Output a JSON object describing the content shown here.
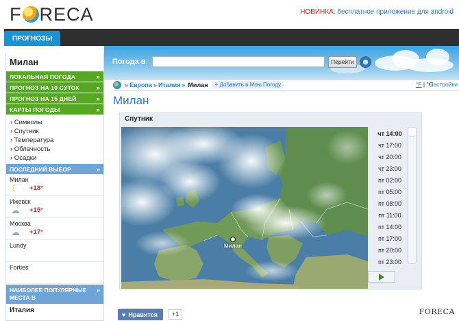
{
  "header": {
    "logo_text_prefix": "F",
    "logo_text_suffix": "RECA",
    "promo_new": "НОВИНКА:",
    "promo_text": " бесплатное приложение для android"
  },
  "nav": {
    "tab_forecasts": "ПРОГНОЗЫ"
  },
  "sidebar": {
    "city": "Милан",
    "green_items": [
      {
        "label": "ЛОКАЛЬНАЯ ПОГОДА",
        "arrow": "»"
      },
      {
        "label": "ПРОГНОЗ НА 10 СУТОК",
        "arrow": "»"
      },
      {
        "label": "ПРОГНОЗ НА 15 ДНЕЙ",
        "arrow": "»"
      },
      {
        "label": "КАРТЫ ПОГОДЫ",
        "arrow": "»"
      }
    ],
    "map_links": [
      "› Символы",
      "› Спутник",
      "› Температура",
      "› Облачность",
      "› Осадки"
    ],
    "recent_header": "ПОСЛЕДНИЙ ВЫБОР",
    "recent_chevron": "»",
    "recent": [
      {
        "name": "Милан",
        "temp": "+18°",
        "icon": "moon-icon"
      },
      {
        "name": "Ижевск",
        "temp": "+15°",
        "icon": "partly-cloudy-icon"
      },
      {
        "name": "Москва",
        "temp": "+17°",
        "icon": "partly-cloudy-icon"
      },
      {
        "name": "Lundy",
        "temp": "",
        "icon": ""
      },
      {
        "name": "Forties",
        "temp": "",
        "icon": ""
      }
    ],
    "popular_header_line1": "НАИБОЛЕЕ ПОПУЛЯРНЫЕ",
    "popular_header_line2": "МЕСТА В",
    "popular_chevron": "»",
    "popular_city": "Италия"
  },
  "search": {
    "label": "Погода в",
    "value": "",
    "placeholder": "",
    "button": "Перейти"
  },
  "breadcrumb": {
    "sep": "»",
    "europe": "Европа",
    "italy": "Италия",
    "current": "Милан",
    "add_favorite": "+ Добавить в Мою Погоду",
    "unit_f": "°F",
    "unit_sep": " | ",
    "unit_c": "°C",
    "settings": "Настройки"
  },
  "page": {
    "title": "Милан"
  },
  "satellite": {
    "title": "Спутник",
    "city_marker": "Милан",
    "times": [
      "чт 14:00",
      "чт 17:00",
      "чт 20:00",
      "чт 23:00",
      "пт 02:00",
      "пт 05:00",
      "пт 08:00",
      "пт 11:00",
      "пт 14:00",
      "пт 17:00",
      "пт 20:00",
      "пт 23:00"
    ],
    "active_time_index": 0
  },
  "footer": {
    "like": "Нравится",
    "like_count": "+1",
    "watermark": "FORECA"
  },
  "colors": {
    "accent_blue": "#1b93d3",
    "green": "#56a823",
    "temp_red": "#d4242a",
    "link_blue": "#2a78c9"
  }
}
